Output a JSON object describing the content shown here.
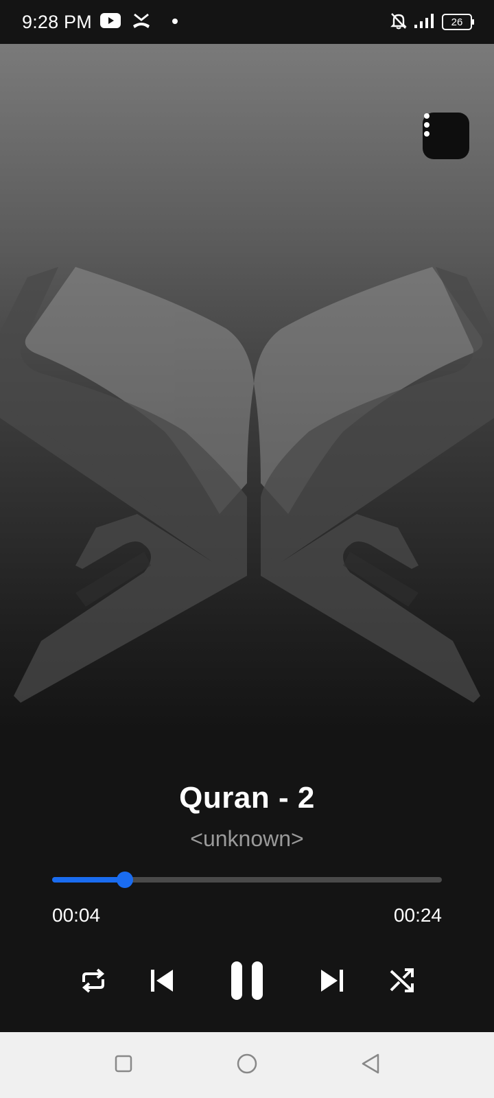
{
  "status_bar": {
    "time": "9:28 PM",
    "battery_level": "26",
    "icons": [
      "youtube-icon",
      "missed-call-icon",
      "notification-dot-icon",
      "bell-off-icon",
      "signal-icon",
      "battery-icon"
    ]
  },
  "player": {
    "title": "Quran - 2",
    "artist": "<unknown>",
    "current_time": "00:04",
    "total_time": "00:24",
    "progress_percent": 18.7,
    "accent_color": "#1a6cf0",
    "artwork_icon": "quran-book-icon",
    "menu_icon": "more-vert-icon"
  },
  "controls": {
    "icons": [
      "repeat-icon",
      "skip-previous-icon",
      "pause-icon",
      "skip-next-icon",
      "shuffle-icon"
    ]
  },
  "nav_bar": {
    "icons": [
      "recents-square-icon",
      "home-circle-icon",
      "back-triangle-icon"
    ]
  }
}
